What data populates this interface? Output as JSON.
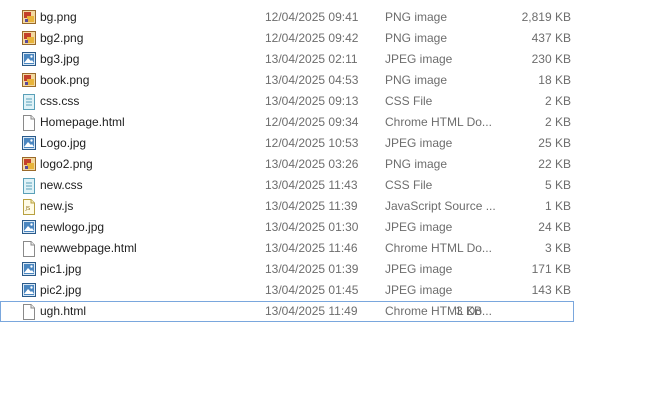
{
  "files": [
    {
      "name": "bg.png",
      "date": "12/04/2025 09:41",
      "type": "PNG image",
      "size": "2,819 KB",
      "icon": "png-image-icon"
    },
    {
      "name": "bg2.png",
      "date": "12/04/2025 09:42",
      "type": "PNG image",
      "size": "437 KB",
      "icon": "png-image-icon"
    },
    {
      "name": "bg3.jpg",
      "date": "13/04/2025 02:11",
      "type": "JPEG image",
      "size": "230 KB",
      "icon": "jpeg-image-icon"
    },
    {
      "name": "book.png",
      "date": "13/04/2025 04:53",
      "type": "PNG image",
      "size": "18 KB",
      "icon": "png-image-icon"
    },
    {
      "name": "css.css",
      "date": "13/04/2025 09:13",
      "type": "CSS File",
      "size": "2 KB",
      "icon": "css-file-icon"
    },
    {
      "name": "Homepage.html",
      "date": "12/04/2025 09:34",
      "type": "Chrome HTML Do...",
      "size": "2 KB",
      "icon": "html-file-icon"
    },
    {
      "name": "Logo.jpg",
      "date": "12/04/2025 10:53",
      "type": "JPEG image",
      "size": "25 KB",
      "icon": "jpeg-image-icon"
    },
    {
      "name": "logo2.png",
      "date": "13/04/2025 03:26",
      "type": "PNG image",
      "size": "22 KB",
      "icon": "png-image-icon"
    },
    {
      "name": "new.css",
      "date": "13/04/2025 11:43",
      "type": "CSS File",
      "size": "5 KB",
      "icon": "css-file-icon"
    },
    {
      "name": "new.js",
      "date": "13/04/2025 11:39",
      "type": "JavaScript Source ...",
      "size": "1 KB",
      "icon": "js-file-icon"
    },
    {
      "name": "newlogo.jpg",
      "date": "13/04/2025 01:30",
      "type": "JPEG image",
      "size": "24 KB",
      "icon": "jpeg-image-icon"
    },
    {
      "name": "newwebpage.html",
      "date": "13/04/2025 11:46",
      "type": "Chrome HTML Do...",
      "size": "3 KB",
      "icon": "html-file-icon"
    },
    {
      "name": "pic1.jpg",
      "date": "13/04/2025 01:39",
      "type": "JPEG image",
      "size": "171 KB",
      "icon": "jpeg-image-icon"
    },
    {
      "name": "pic2.jpg",
      "date": "13/04/2025 01:45",
      "type": "JPEG image",
      "size": "143 KB",
      "icon": "jpeg-image-icon"
    },
    {
      "name": "ugh.html",
      "date": "13/04/2025 11:49",
      "type": "Chrome HTML Do...",
      "size": "3 KB",
      "icon": "html-file-icon",
      "selected": true
    }
  ]
}
